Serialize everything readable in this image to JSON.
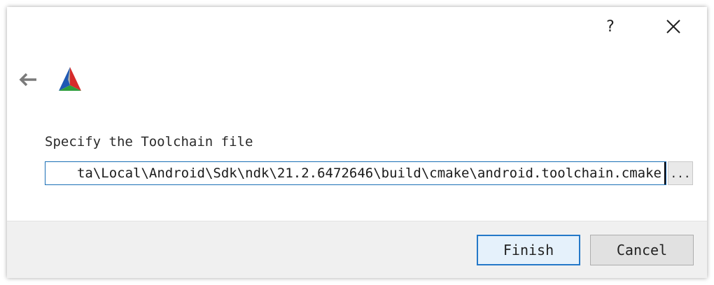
{
  "titlebar": {
    "help_label": "?",
    "close_icon": "close-icon"
  },
  "nav": {
    "back_icon": "back-arrow-icon",
    "logo_icon": "cmake-logo-icon"
  },
  "main": {
    "prompt": "Specify the Toolchain file",
    "toolchain_path": "ta\\Local\\Android\\Sdk\\ndk\\21.2.6472646\\build\\cmake\\android.toolchain.cmake",
    "browse_label": "..."
  },
  "footer": {
    "finish_label": "Finish",
    "cancel_label": "Cancel"
  },
  "colors": {
    "focus_border": "#1a6fb5",
    "default_button_border": "#2478c8",
    "footer_bg": "#f0f0f0"
  }
}
